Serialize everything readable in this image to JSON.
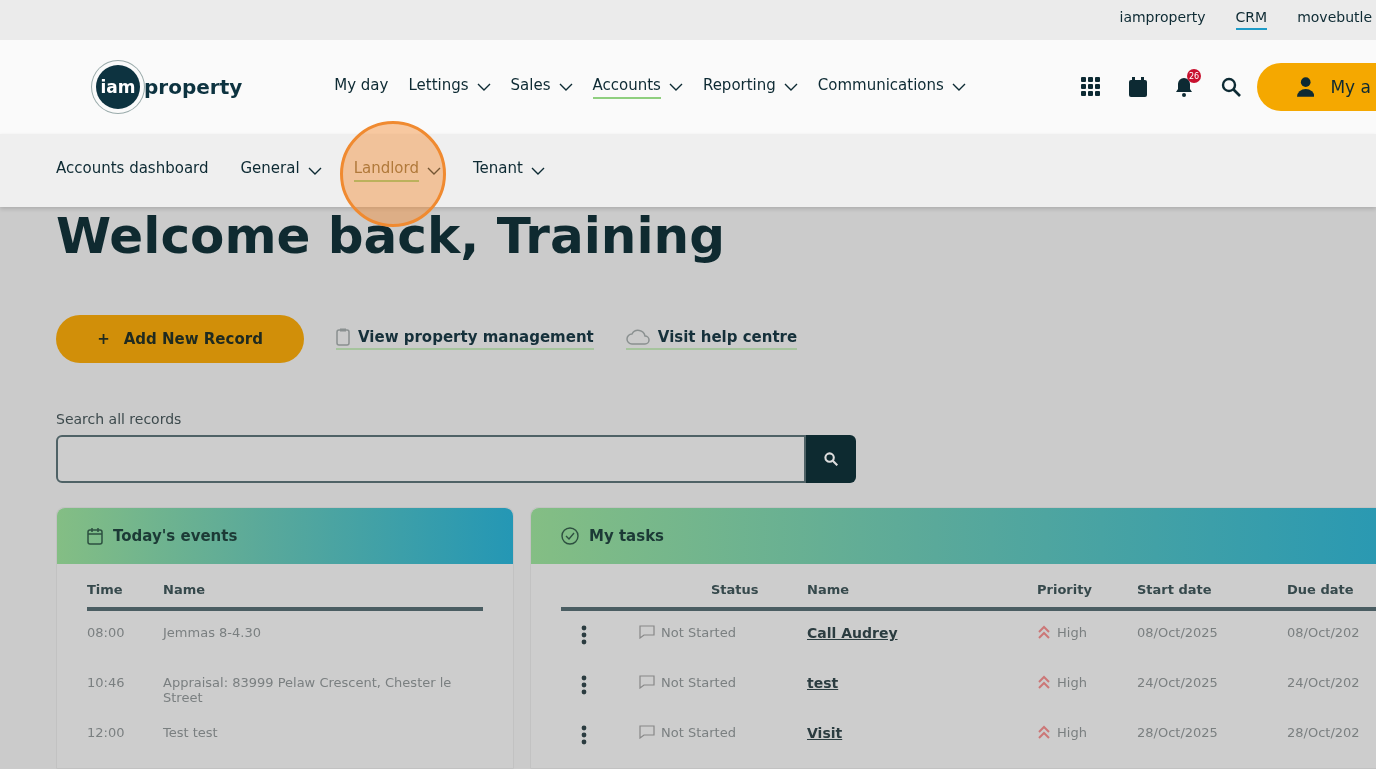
{
  "top_links": [
    {
      "label": "iamproperty",
      "selected": false
    },
    {
      "label": "CRM",
      "selected": true
    },
    {
      "label": "movebutle",
      "selected": false
    }
  ],
  "logo": {
    "circle_text": "iam",
    "text": "property"
  },
  "main_nav": [
    {
      "label": "My day",
      "dropdown": false,
      "selected": false
    },
    {
      "label": "Lettings",
      "dropdown": true,
      "selected": false
    },
    {
      "label": "Sales",
      "dropdown": true,
      "selected": false
    },
    {
      "label": "Accounts",
      "dropdown": true,
      "selected": true
    },
    {
      "label": "Reporting",
      "dropdown": true,
      "selected": false
    },
    {
      "label": "Communications",
      "dropdown": true,
      "selected": false
    }
  ],
  "notifications": {
    "count": "26"
  },
  "account_button": {
    "label": "My a"
  },
  "sub_nav": [
    {
      "label": "Accounts dashboard",
      "dropdown": false,
      "selected": false
    },
    {
      "label": "General",
      "dropdown": true,
      "selected": false
    },
    {
      "label": "Landlord",
      "dropdown": true,
      "selected": true
    },
    {
      "label": "Tenant",
      "dropdown": true,
      "selected": false
    }
  ],
  "heading": "Welcome back, Training",
  "actions": {
    "primary": {
      "icon": "+",
      "label": "Add New Record"
    },
    "links": [
      {
        "kind": "clipboard",
        "label": "View property management"
      },
      {
        "kind": "cloud",
        "label": "Visit help centre"
      }
    ]
  },
  "search": {
    "label": "Search all records"
  },
  "events": {
    "title": "Today's events",
    "columns": [
      "Time",
      "Name"
    ],
    "rows": [
      {
        "time": "08:00",
        "name": "Jemmas 8-4.30"
      },
      {
        "time": "10:46",
        "name": "Appraisal: 83999 Pelaw Crescent, Chester le Street"
      },
      {
        "time": "12:00",
        "name": "Test test"
      }
    ]
  },
  "tasks": {
    "title": "My tasks",
    "columns": [
      "Status",
      "Name",
      "Priority",
      "Start date",
      "Due date"
    ],
    "rows": [
      {
        "status": "Not Started",
        "name": "Call Audrey",
        "priority": "High",
        "start": "08/Oct/2025",
        "due": "08/Oct/202"
      },
      {
        "status": "Not Started",
        "name": "test",
        "priority": "High",
        "start": "24/Oct/2025",
        "due": "24/Oct/202"
      },
      {
        "status": "Not Started",
        "name": "Visit",
        "priority": "High",
        "start": "28/Oct/2025",
        "due": "28/Oct/202"
      }
    ]
  }
}
